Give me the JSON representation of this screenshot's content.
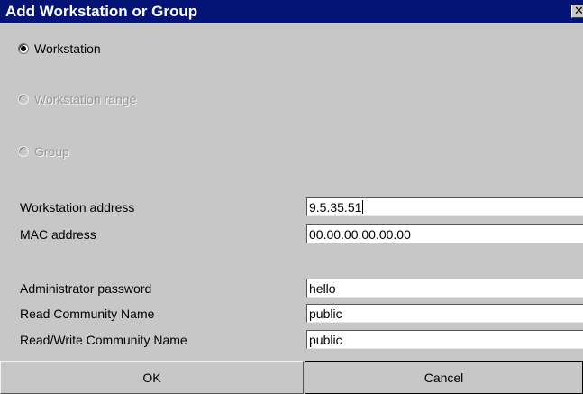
{
  "dialog": {
    "title": "Add Workstation or Group",
    "close_glyph": "✕"
  },
  "radios": [
    {
      "label": "Workstation",
      "checked": true,
      "enabled": true
    },
    {
      "label": "Workstation range",
      "checked": false,
      "enabled": false
    },
    {
      "label": "Group",
      "checked": false,
      "enabled": false
    }
  ],
  "fields": {
    "workstation_address": {
      "label": "Workstation address",
      "value": "9.5.35.51"
    },
    "mac_address": {
      "label": "MAC address",
      "value": "00.00.00.00.00.00"
    },
    "admin_password": {
      "label": "Administrator password",
      "value": "hello"
    },
    "read_community": {
      "label": "Read Community Name",
      "value": "public"
    },
    "readwrite_community": {
      "label": "Read/Write Community Name",
      "value": "public"
    }
  },
  "buttons": {
    "ok": "OK",
    "cancel": "Cancel"
  }
}
